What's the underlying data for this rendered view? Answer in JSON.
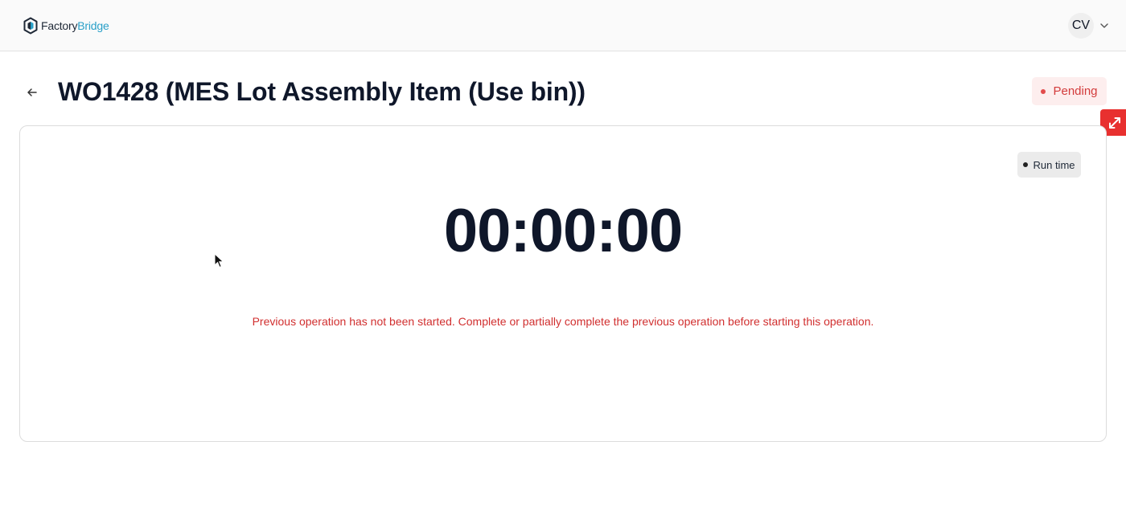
{
  "header": {
    "logo": {
      "text_part1": "Factory",
      "text_part2": "Bridge",
      "accent_color": "#2aa0c8",
      "icon": "factorybridge-logo-icon"
    },
    "user": {
      "initials": "CV",
      "menu_icon": "chevron-down-icon"
    }
  },
  "page": {
    "back_icon": "arrow-left-icon",
    "title": "WO1428 (MES Lot Assembly Item (Use bin))",
    "status": {
      "label": "Pending",
      "color": "#d33b3b",
      "background": "#fdeeee"
    },
    "expand_icon": "expand-diagonal-icon",
    "expand_color": "#e8302f"
  },
  "timer": {
    "mode_chip": "Run time",
    "value": "00:00:00",
    "message": "Previous operation has not been started. Complete or partially complete the previous operation before starting this operation.",
    "message_color": "#d12f2f"
  }
}
